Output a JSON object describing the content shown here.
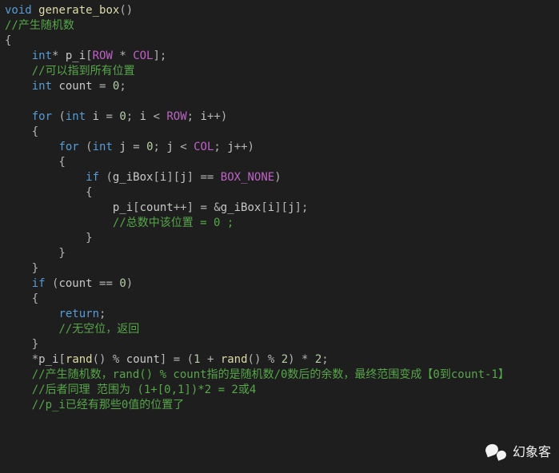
{
  "watermark": {
    "text": "幻象客"
  },
  "code": [
    [
      {
        "c": "type",
        "t": "void"
      },
      {
        "c": "op",
        "t": " "
      },
      {
        "c": "fn",
        "t": "generate_box"
      },
      {
        "c": "op",
        "t": "()"
      }
    ],
    [
      {
        "c": "cmt",
        "t": "//产生随机数"
      }
    ],
    [
      {
        "c": "op",
        "t": "{"
      }
    ],
    [
      {
        "c": "op",
        "t": "    "
      },
      {
        "c": "type",
        "t": "int"
      },
      {
        "c": "op",
        "t": "* "
      },
      {
        "c": "var",
        "t": "p_i"
      },
      {
        "c": "op",
        "t": "["
      },
      {
        "c": "macro",
        "t": "ROW"
      },
      {
        "c": "op",
        "t": " * "
      },
      {
        "c": "macro",
        "t": "COL"
      },
      {
        "c": "op",
        "t": "];"
      }
    ],
    [
      {
        "c": "op",
        "t": "    "
      },
      {
        "c": "cmt",
        "t": "//可以指到所有位置"
      }
    ],
    [
      {
        "c": "op",
        "t": "    "
      },
      {
        "c": "type",
        "t": "int"
      },
      {
        "c": "op",
        "t": " "
      },
      {
        "c": "var",
        "t": "count"
      },
      {
        "c": "op",
        "t": " = "
      },
      {
        "c": "num",
        "t": "0"
      },
      {
        "c": "op",
        "t": ";"
      }
    ],
    [],
    [
      {
        "c": "op",
        "t": "    "
      },
      {
        "c": "kw",
        "t": "for"
      },
      {
        "c": "op",
        "t": " ("
      },
      {
        "c": "type",
        "t": "int"
      },
      {
        "c": "op",
        "t": " "
      },
      {
        "c": "var",
        "t": "i"
      },
      {
        "c": "op",
        "t": " = "
      },
      {
        "c": "num",
        "t": "0"
      },
      {
        "c": "op",
        "t": "; "
      },
      {
        "c": "var",
        "t": "i"
      },
      {
        "c": "op",
        "t": " < "
      },
      {
        "c": "macro",
        "t": "ROW"
      },
      {
        "c": "op",
        "t": "; "
      },
      {
        "c": "var",
        "t": "i"
      },
      {
        "c": "op",
        "t": "++)"
      }
    ],
    [
      {
        "c": "op",
        "t": "    {"
      }
    ],
    [
      {
        "c": "op",
        "t": "        "
      },
      {
        "c": "kw",
        "t": "for"
      },
      {
        "c": "op",
        "t": " ("
      },
      {
        "c": "type",
        "t": "int"
      },
      {
        "c": "op",
        "t": " "
      },
      {
        "c": "var",
        "t": "j"
      },
      {
        "c": "op",
        "t": " = "
      },
      {
        "c": "num",
        "t": "0"
      },
      {
        "c": "op",
        "t": "; "
      },
      {
        "c": "var",
        "t": "j"
      },
      {
        "c": "op",
        "t": " < "
      },
      {
        "c": "macro",
        "t": "COL"
      },
      {
        "c": "op",
        "t": "; "
      },
      {
        "c": "var",
        "t": "j"
      },
      {
        "c": "op",
        "t": "++)"
      }
    ],
    [
      {
        "c": "op",
        "t": "        {"
      }
    ],
    [
      {
        "c": "op",
        "t": "            "
      },
      {
        "c": "kw",
        "t": "if"
      },
      {
        "c": "op",
        "t": " ("
      },
      {
        "c": "var",
        "t": "g_iBox"
      },
      {
        "c": "op",
        "t": "["
      },
      {
        "c": "var",
        "t": "i"
      },
      {
        "c": "op",
        "t": "]["
      },
      {
        "c": "var",
        "t": "j"
      },
      {
        "c": "op",
        "t": "] == "
      },
      {
        "c": "macro",
        "t": "BOX_NONE"
      },
      {
        "c": "op",
        "t": ")"
      }
    ],
    [
      {
        "c": "op",
        "t": "            {"
      }
    ],
    [
      {
        "c": "op",
        "t": "                "
      },
      {
        "c": "var",
        "t": "p_i"
      },
      {
        "c": "op",
        "t": "["
      },
      {
        "c": "var",
        "t": "count"
      },
      {
        "c": "op",
        "t": "++] = &"
      },
      {
        "c": "var",
        "t": "g_iBox"
      },
      {
        "c": "op",
        "t": "["
      },
      {
        "c": "var",
        "t": "i"
      },
      {
        "c": "op",
        "t": "]["
      },
      {
        "c": "var",
        "t": "j"
      },
      {
        "c": "op",
        "t": "];"
      }
    ],
    [
      {
        "c": "op",
        "t": "                "
      },
      {
        "c": "cmt",
        "t": "//总数中该位置 = 0 ;"
      }
    ],
    [
      {
        "c": "op",
        "t": "            }"
      }
    ],
    [
      {
        "c": "op",
        "t": "        }"
      }
    ],
    [
      {
        "c": "op",
        "t": "    }"
      }
    ],
    [
      {
        "c": "op",
        "t": "    "
      },
      {
        "c": "kw",
        "t": "if"
      },
      {
        "c": "op",
        "t": " ("
      },
      {
        "c": "var",
        "t": "count"
      },
      {
        "c": "op",
        "t": " == "
      },
      {
        "c": "num",
        "t": "0"
      },
      {
        "c": "op",
        "t": ")"
      }
    ],
    [
      {
        "c": "op",
        "t": "    {"
      }
    ],
    [
      {
        "c": "op",
        "t": "        "
      },
      {
        "c": "kw",
        "t": "return"
      },
      {
        "c": "op",
        "t": ";"
      }
    ],
    [
      {
        "c": "op",
        "t": "        "
      },
      {
        "c": "cmt",
        "t": "//无空位，返回"
      }
    ],
    [
      {
        "c": "op",
        "t": "    }"
      }
    ],
    [
      {
        "c": "op",
        "t": "    *"
      },
      {
        "c": "var",
        "t": "p_i"
      },
      {
        "c": "op",
        "t": "["
      },
      {
        "c": "fn",
        "t": "rand"
      },
      {
        "c": "op",
        "t": "() % "
      },
      {
        "c": "var",
        "t": "count"
      },
      {
        "c": "op",
        "t": "] = ("
      },
      {
        "c": "num",
        "t": "1"
      },
      {
        "c": "op",
        "t": " + "
      },
      {
        "c": "fn",
        "t": "rand"
      },
      {
        "c": "op",
        "t": "() % "
      },
      {
        "c": "num",
        "t": "2"
      },
      {
        "c": "op",
        "t": ") * "
      },
      {
        "c": "num",
        "t": "2"
      },
      {
        "c": "op",
        "t": ";"
      }
    ],
    [
      {
        "c": "op",
        "t": "    "
      },
      {
        "c": "cmt",
        "t": "//产生随机数，rand() % count指的是随机数/0数后的余数，最终范围变成【0到count-1】"
      }
    ],
    [
      {
        "c": "op",
        "t": "    "
      },
      {
        "c": "cmt",
        "t": "//后者同理 范围为 (1+[0,1])*2 = 2或4"
      }
    ],
    [
      {
        "c": "op",
        "t": "    "
      },
      {
        "c": "cmt",
        "t": "//p_i已经有那些0值的位置了"
      }
    ]
  ]
}
